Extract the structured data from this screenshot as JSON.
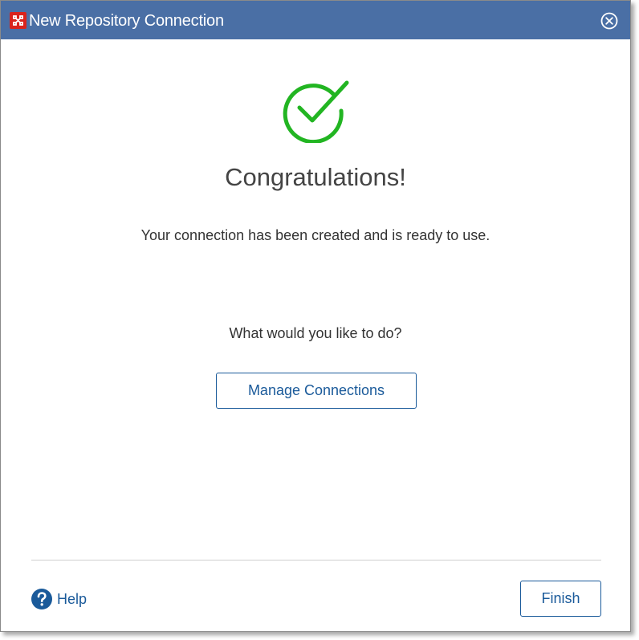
{
  "window": {
    "title": "New Repository Connection",
    "app_icon": "repository-app-icon",
    "close_icon": "close-circle-icon",
    "titlebar_color": "#4a6fa5"
  },
  "main": {
    "status_icon": "check-circle-icon",
    "status_color": "#22b522",
    "heading": "Congratulations!",
    "message": "Your connection has been created and is ready to use.",
    "question": "What would you like to do?",
    "manage_button_label": "Manage Connections"
  },
  "footer": {
    "help_icon": "help-icon",
    "help_label": "Help",
    "finish_button_label": "Finish",
    "accent_color": "#1a5a9a"
  }
}
